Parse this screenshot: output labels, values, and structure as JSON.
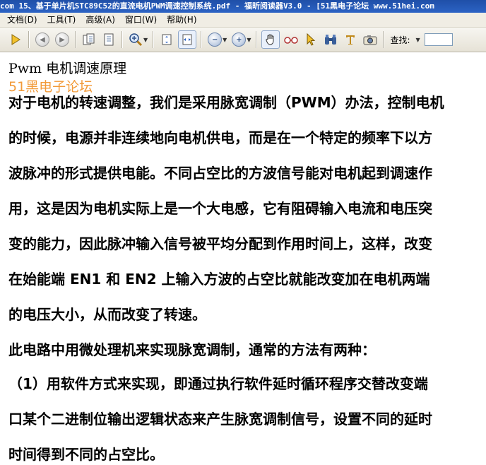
{
  "window": {
    "title": "com 15、基于单片机STC89C52的直流电机PWM调速控制系统.pdf - 福昕阅读器V3.0 - [51黑电子论坛 www.51hei.com"
  },
  "menu": {
    "items": [
      "文档(D)",
      "工具(T)",
      "高级(A)",
      "窗口(W)",
      "帮助(H)"
    ]
  },
  "toolbar": {
    "find_label": "查找:",
    "find_value": ""
  },
  "document": {
    "heading": "Pwm 电机调速原理",
    "site_label": "51黑电子论坛",
    "lines": [
      "对于电机的转速调整，我们是采用脉宽调制（PWM）办法，控制电机",
      "的时候，电源并非连续地向电机供电，而是在一个特定的频率下以方",
      "波脉冲的形式提供电能。不同占空比的方波信号能对电机起到调速作",
      "用，这是因为电机实际上是一个大电感，它有阻碍输入电流和电压突",
      "变的能力，因此脉冲输入信号被平均分配到作用时间上，这样，改变",
      "在始能端 EN1   和 EN2   上输入方波的占空比就能改变加在电机两端",
      "的电压大小，从而改变了转速。",
      "此电路中用微处理机来实现脉宽调制，通常的方法有两种：",
      "（1）用软件方式来实现，即通过执行软件延时循环程序交替改变端",
      "口某个二进制位输出逻辑状态来产生脉宽调制信号，设置不同的延时",
      "时间得到不同的占空比。"
    ]
  },
  "colors": {
    "title_bar": "#2c63c4",
    "site_label": "#f29a38"
  }
}
